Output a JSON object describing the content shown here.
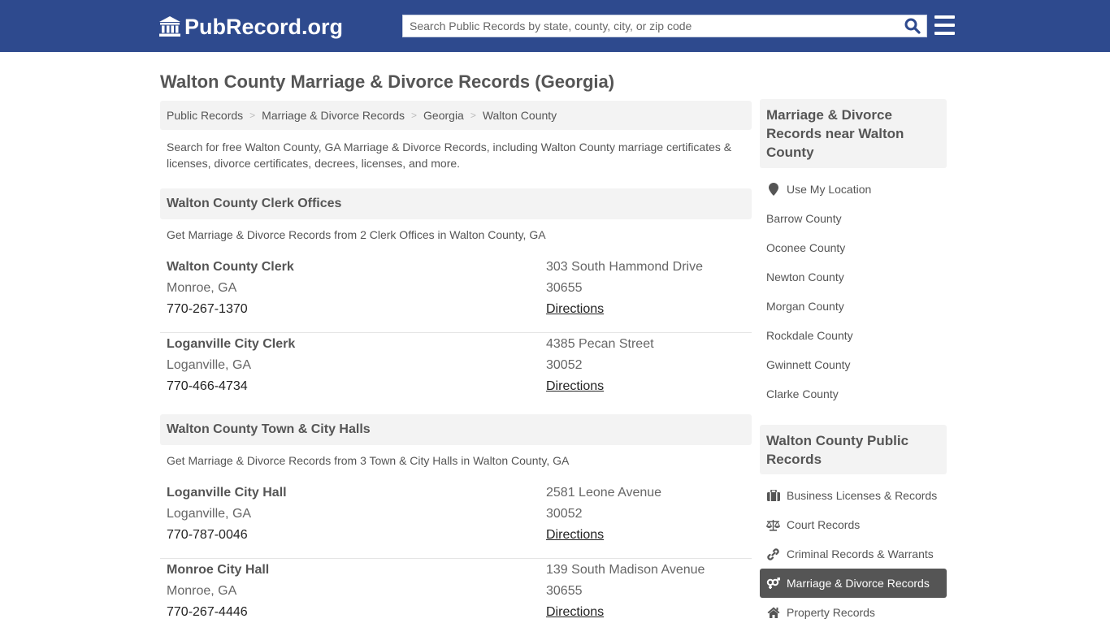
{
  "header": {
    "logo_text": "PubRecord.org",
    "search_placeholder": "Search Public Records by state, county, city, or zip code",
    "brand_color": "#2e4a8e"
  },
  "page_title": "Walton County Marriage & Divorce Records (Georgia)",
  "breadcrumb": [
    "Public Records",
    "Marriage & Divorce Records",
    "Georgia",
    "Walton County"
  ],
  "intro": "Search for free Walton County, GA Marriage & Divorce Records, including Walton County marriage certificates & licenses, divorce certificates, decrees, licenses, and more.",
  "sections": [
    {
      "title": "Walton County Clerk Offices",
      "subtitle": "Get Marriage & Divorce Records from 2 Clerk Offices in Walton County, GA",
      "entries": [
        {
          "name": "Walton County Clerk",
          "city": "Monroe, GA",
          "phone": "770-267-1370",
          "address": "303 South Hammond Drive",
          "zip": "30655",
          "directions": "Directions"
        },
        {
          "name": "Loganville City Clerk",
          "city": "Loganville, GA",
          "phone": "770-466-4734",
          "address": "4385 Pecan Street",
          "zip": "30052",
          "directions": "Directions"
        }
      ]
    },
    {
      "title": "Walton County Town & City Halls",
      "subtitle": "Get Marriage & Divorce Records from 3 Town & City Halls in Walton County, GA",
      "entries": [
        {
          "name": "Loganville City Hall",
          "city": "Loganville, GA",
          "phone": "770-787-0046",
          "address": "2581 Leone Avenue",
          "zip": "30052",
          "directions": "Directions"
        },
        {
          "name": "Monroe City Hall",
          "city": "Monroe, GA",
          "phone": "770-267-4446",
          "address": "139 South Madison Avenue",
          "zip": "30655",
          "directions": "Directions"
        }
      ]
    }
  ],
  "sidebar": {
    "nearby": {
      "title": "Marriage & Divorce Records near Walton County",
      "use_location": "Use My Location",
      "counties": [
        "Barrow County",
        "Oconee County",
        "Newton County",
        "Morgan County",
        "Rockdale County",
        "Gwinnett County",
        "Clarke County"
      ]
    },
    "public_records": {
      "title": "Walton County Public Records",
      "items": [
        {
          "label": "Business Licenses & Records",
          "icon": "briefcase-icon",
          "active": false
        },
        {
          "label": "Court Records",
          "icon": "scales-icon",
          "active": false
        },
        {
          "label": "Criminal Records & Warrants",
          "icon": "link-icon",
          "active": false
        },
        {
          "label": "Marriage & Divorce Records",
          "icon": "gender-icon",
          "active": true
        },
        {
          "label": "Property Records",
          "icon": "home-icon",
          "active": false
        }
      ]
    }
  }
}
